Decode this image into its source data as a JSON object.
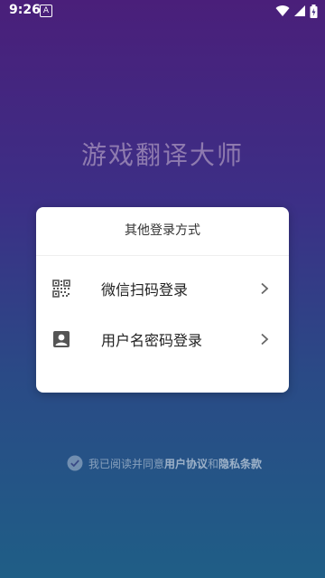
{
  "status_bar": {
    "time": "9:26",
    "notification_letter": "A"
  },
  "app_title": "游戏翻译大师",
  "login_card": {
    "header": "其他登录方式",
    "options": [
      {
        "label": "微信扫码登录",
        "icon": "qr-code-icon"
      },
      {
        "label": "用户名密码登录",
        "icon": "account-box-icon"
      }
    ]
  },
  "agreement": {
    "prefix": "我已阅读并同意",
    "user_agreement": "用户协议",
    "conjunction": "和",
    "privacy_policy": "隐私条款"
  },
  "colors": {
    "gradient_top": "#4a1f7a",
    "gradient_bottom": "#1f5e86",
    "card_bg": "#ffffff"
  }
}
